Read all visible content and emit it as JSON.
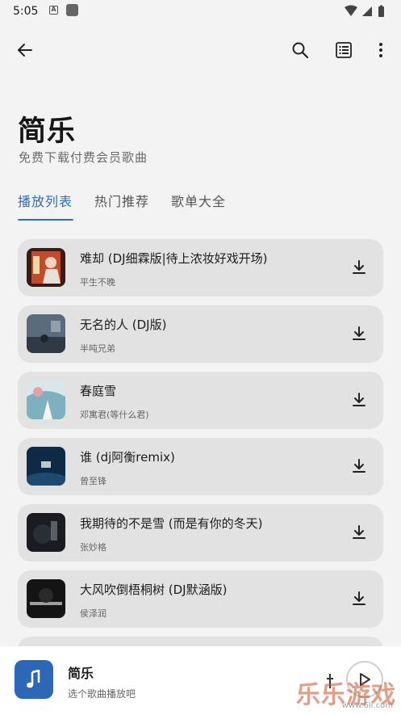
{
  "status": {
    "time": "5:05",
    "a_badge": "A"
  },
  "app": {
    "title": "简乐",
    "subtitle": "免费下载付费会员歌曲"
  },
  "tabs": [
    {
      "label": "播放列表",
      "active": true
    },
    {
      "label": "热门推荐",
      "active": false
    },
    {
      "label": "歌单大全",
      "active": false
    }
  ],
  "songs": [
    {
      "title": "难却 (DJ细霖版|待上浓妆好戏开场)",
      "artist": "平生不晚"
    },
    {
      "title": "无名的人 (DJ版)",
      "artist": "半吨兄弟"
    },
    {
      "title": "春庭雪",
      "artist": "邓寓君(等什么君)"
    },
    {
      "title": "谁 (dj阿衡remix)",
      "artist": "曾至锋"
    },
    {
      "title": "我期待的不是雪 (而是有你的冬天)",
      "artist": "张妙格"
    },
    {
      "title": "大风吹倒梧桐树 (DJ默涵版)",
      "artist": "侯泽润"
    }
  ],
  "player": {
    "title": "简乐",
    "subtitle": "选个歌曲播放吧"
  },
  "watermark": {
    "text": "乐乐游戏",
    "url": "www.6ll.com"
  },
  "colors": {
    "accent": "#2f6db4",
    "card": "#e2e2e2",
    "background": "#f3f3f3"
  }
}
